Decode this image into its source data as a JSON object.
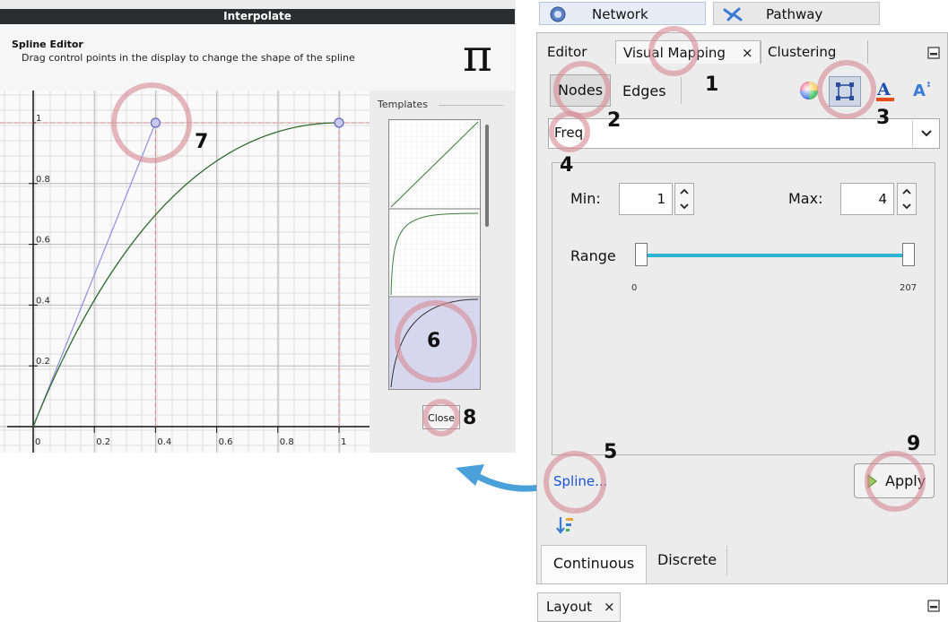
{
  "dialog": {
    "title": "Interpolate",
    "heading": "Spline Editor",
    "description": "Drag control points in the display to change the shape of the spline",
    "pi_symbol": "π",
    "templates_label": "Templates",
    "close_label": "Close"
  },
  "plot": {
    "x_ticks": [
      "0",
      "0.2",
      "0.4",
      "0.6",
      "0.8",
      "1"
    ],
    "y_ticks": [
      "0.2",
      "0.4",
      "0.6",
      "0.8",
      "1"
    ],
    "curve_color": "#2e6b2e",
    "control_line_color": "#8e8ee0",
    "guide_color": "#d88888",
    "control_point": [
      0.4,
      1.0
    ],
    "end_point": [
      1.0,
      1.0
    ]
  },
  "window_tabs": {
    "network": "Network",
    "pathway": "Pathway"
  },
  "panel_tabs": {
    "editor": "Editor",
    "visual_mapping": "Visual Mapping",
    "clustering": "Clustering",
    "close_glyph": "×"
  },
  "toggle": {
    "nodes": "Nodes",
    "edges": "Edges"
  },
  "attribute": {
    "selected": "Freq"
  },
  "range": {
    "min_label": "Min:",
    "min_value": "1",
    "max_label": "Max:",
    "max_value": "4",
    "range_label": "Range",
    "slider_min": "0",
    "slider_max": "207",
    "slider_color": "#2ab3d3"
  },
  "actions": {
    "spline_link": "Spline...",
    "apply_label": "Apply"
  },
  "bottom_tabs": {
    "continuous": "Continuous",
    "discrete": "Discrete"
  },
  "layout_tab": {
    "label": "Layout"
  },
  "annotations": {
    "n1": "1",
    "n2": "2",
    "n3": "3",
    "n4": "4",
    "n5": "5",
    "n6": "6",
    "n7": "7",
    "n8": "8",
    "n9": "9"
  },
  "colors": {
    "title_bar": "#2b2d2e",
    "link": "#1a53d6",
    "annotation_ring": "#d78c96",
    "arrow": "#4aa0d8"
  }
}
